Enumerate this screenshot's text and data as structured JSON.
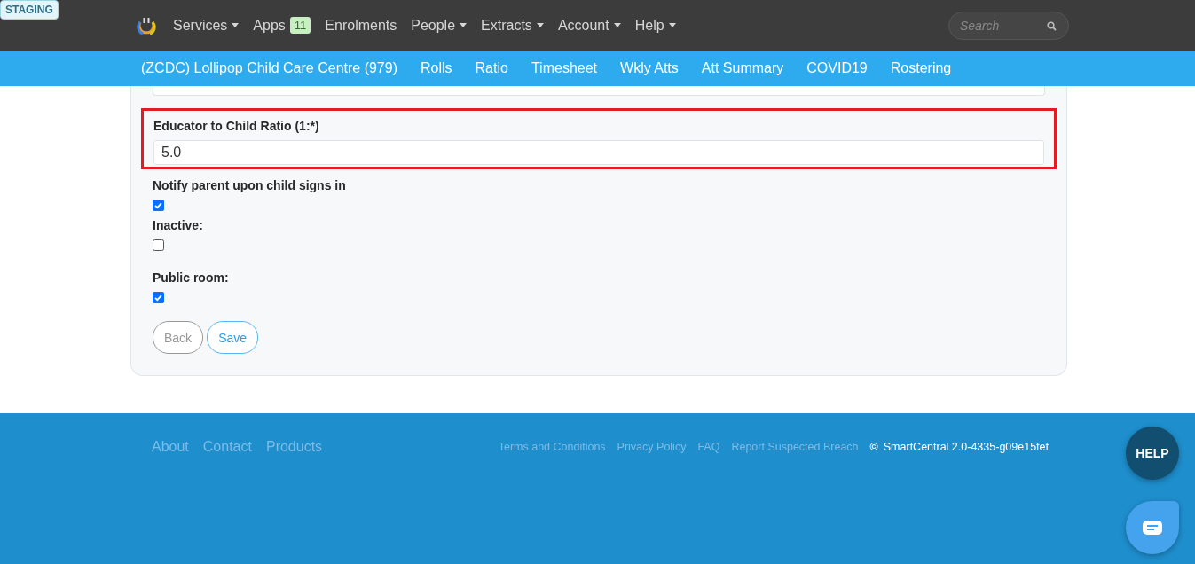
{
  "badge": "STAGING",
  "nav": {
    "items": [
      {
        "label": "Services",
        "dropdown": true
      },
      {
        "label": "Apps",
        "dropdown": false,
        "count": "11"
      },
      {
        "label": "Enrolments",
        "dropdown": false
      },
      {
        "label": "People",
        "dropdown": true
      },
      {
        "label": "Extracts",
        "dropdown": true
      },
      {
        "label": "Account",
        "dropdown": true
      },
      {
        "label": "Help",
        "dropdown": true
      }
    ],
    "search": {
      "placeholder": "Search"
    }
  },
  "subnav": [
    "(ZCDC) Lollipop Child Care Centre (979)",
    "Rolls",
    "Ratio",
    "Timesheet",
    "Wkly Atts",
    "Att Summary",
    "COVID19",
    "Rostering"
  ],
  "form": {
    "ratio": {
      "label": "Educator to Child Ratio (1:*)",
      "value": "5.0",
      "highlighted": true
    },
    "checks": [
      {
        "label": "Notify parent upon child signs in",
        "checked": true
      },
      {
        "label": "Inactive:",
        "checked": false
      },
      {
        "label": "Public room:",
        "checked": true
      }
    ],
    "buttons": [
      {
        "label": "Back",
        "kind": "secondary"
      },
      {
        "label": "Save",
        "kind": "primary"
      }
    ]
  },
  "footer": {
    "left": [
      "About",
      "Contact",
      "Products"
    ],
    "right": [
      "Terms and Conditions",
      "Privacy Policy",
      "FAQ",
      "Report Suspected Breach"
    ],
    "copyright": "©",
    "version": "SmartCentral 2.0-4335-g09e15fef"
  },
  "help_button": "HELP"
}
